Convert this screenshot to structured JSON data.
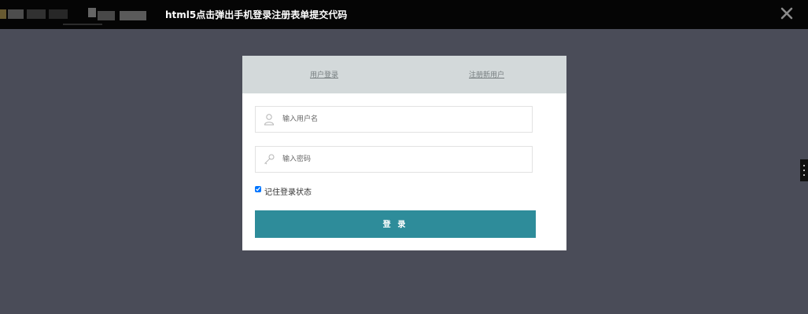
{
  "header": {
    "title": "html5点击弹出手机登录注册表单提交代码",
    "close_icon": "close-icon"
  },
  "modal": {
    "tabs": [
      {
        "label": "用户登录"
      },
      {
        "label": "注册新用户"
      }
    ],
    "username": {
      "placeholder": "输入用户名",
      "value": "",
      "icon": "user-icon"
    },
    "password": {
      "placeholder": "输入密码",
      "value": "",
      "icon": "key-icon"
    },
    "remember": {
      "label": "记住登录状态",
      "checked": true
    },
    "submit_label": "登 录"
  },
  "colors": {
    "background": "#4a4c58",
    "topbar": "#050505",
    "tab_bar": "#d3d9da",
    "button": "#2e8c9a"
  }
}
